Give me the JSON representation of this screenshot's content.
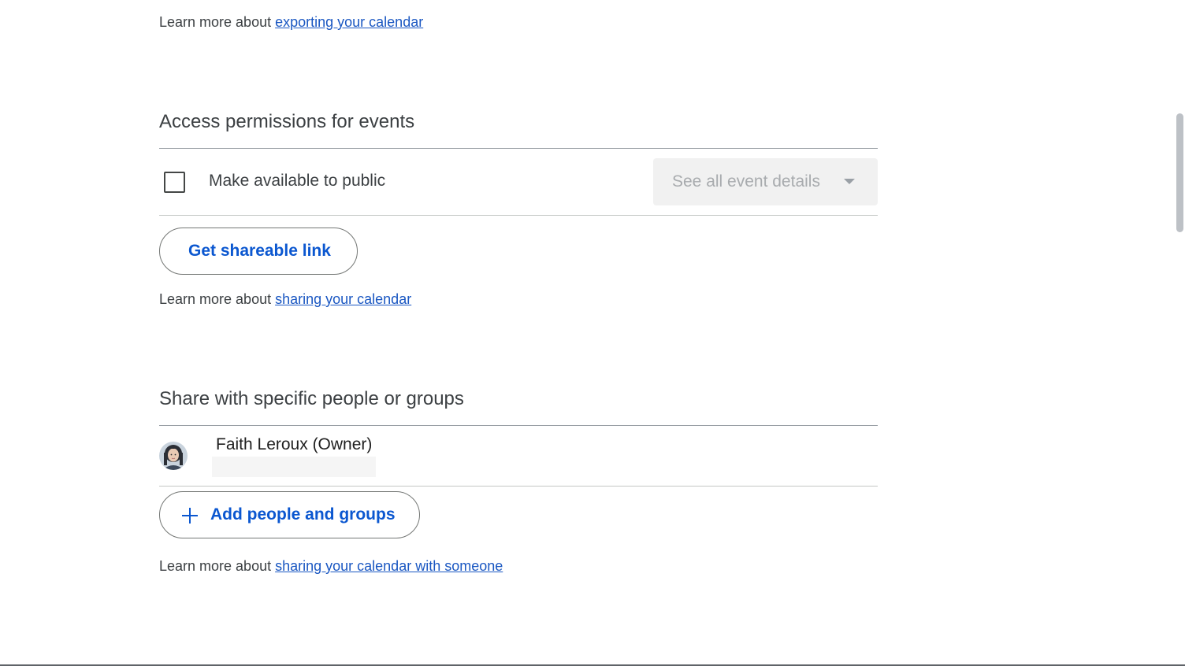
{
  "export_section": {
    "learn_more_prefix": "Learn more about ",
    "learn_more_link": "exporting your calendar"
  },
  "access_section": {
    "title": "Access permissions for events",
    "public_checkbox_label": "Make available to public",
    "public_checkbox_checked": false,
    "visibility_select_value": "See all event details",
    "share_link_button": "Get shareable link",
    "learn_more_prefix": "Learn more about ",
    "learn_more_link": "sharing your calendar"
  },
  "share_section": {
    "title": "Share with specific people or groups",
    "people": [
      {
        "name": "Faith Leroux (Owner)",
        "avatar_icon": "user-avatar-photo"
      }
    ],
    "add_button": "Add people and groups",
    "add_button_icon": "plus-icon",
    "learn_more_prefix": "Learn more about ",
    "learn_more_link": "sharing your calendar with someone"
  },
  "colors": {
    "link": "#1a57c2",
    "button_text": "#0b57d0",
    "select_bg": "#f1f1f1"
  }
}
